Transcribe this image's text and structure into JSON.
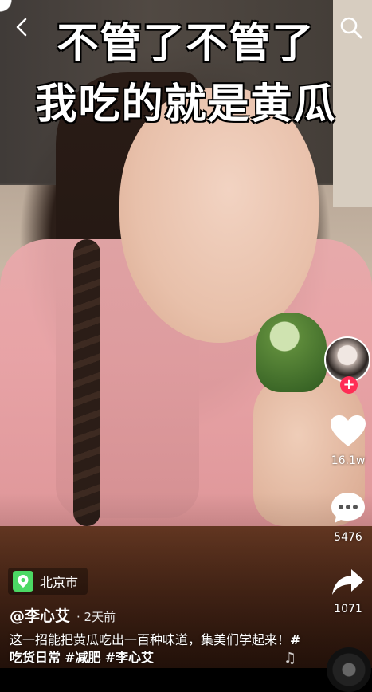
{
  "video": {
    "caption_line1": "不管了不管了",
    "caption_line2": "我吃的就是黄瓜"
  },
  "nav": {
    "back_icon": "chevron-left-icon",
    "search_icon": "search-icon"
  },
  "rail": {
    "follow_plus": "+",
    "likes": "16.1w",
    "comments": "5476",
    "shares": "1071"
  },
  "location": {
    "label": "北京市"
  },
  "author": {
    "handle": "@李心艾",
    "time": "· 2天前"
  },
  "description": {
    "text": "这一招能把黄瓜吃出一百种味道，集美们学起来！",
    "tags": [
      "#吃货日常",
      "#减肥",
      "#李心艾"
    ]
  },
  "music": {
    "note": "♫"
  },
  "colors": {
    "follow_badge": "#ff2d55",
    "location_badge": "#4cd964"
  }
}
